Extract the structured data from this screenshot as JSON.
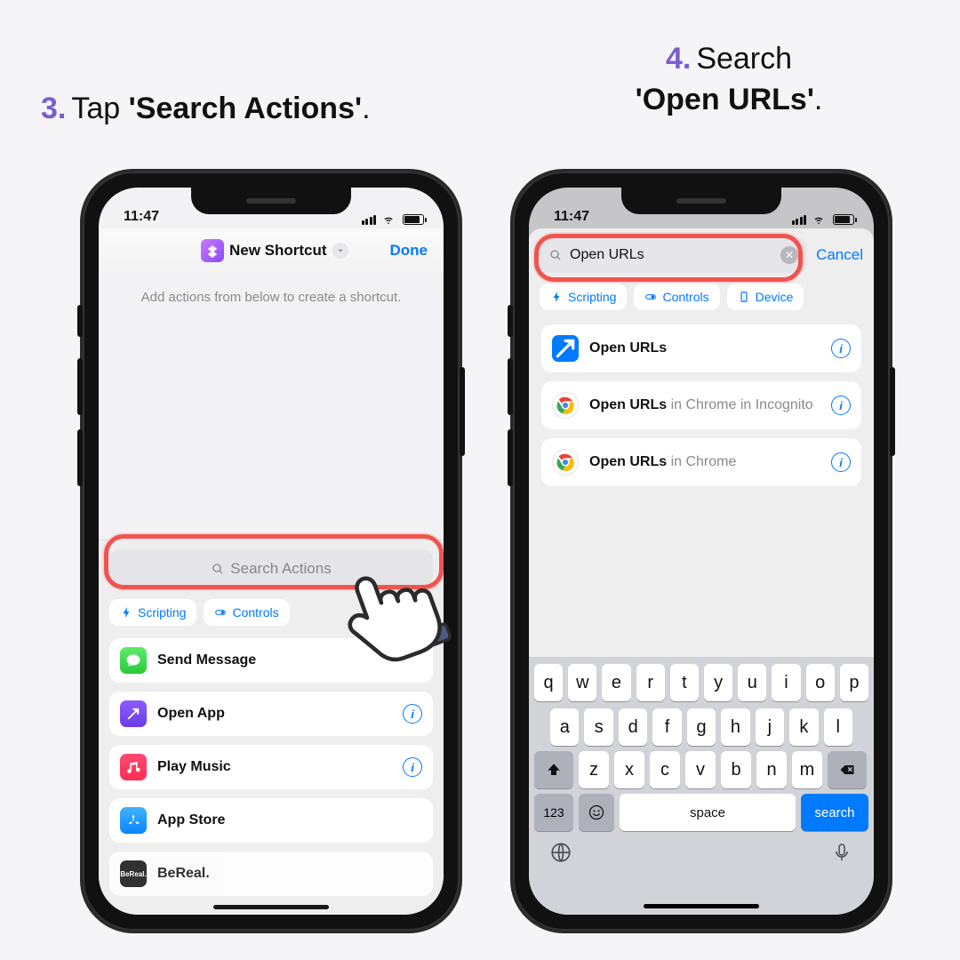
{
  "captions": {
    "step3": {
      "num": "3.",
      "pre": "Tap ",
      "bold": "'Search Actions'",
      "post": "."
    },
    "step4": {
      "num": "4.",
      "pre": "Search ",
      "bold": "'Open URLs'",
      "post": "."
    }
  },
  "status": {
    "time": "11:47"
  },
  "phone1": {
    "title": "New Shortcut",
    "done": "Done",
    "hint": "Add actions from below to create a shortcut.",
    "search_placeholder": "Search Actions",
    "chips": [
      "Scripting",
      "Controls"
    ],
    "rows": [
      {
        "icon": "messages",
        "title": "Send Message",
        "info": false
      },
      {
        "icon": "openapp",
        "title": "Open App",
        "info": true
      },
      {
        "icon": "music",
        "title": "Play Music",
        "info": true
      },
      {
        "icon": "appstore",
        "title": "App Store",
        "info": false
      },
      {
        "icon": "bereal",
        "title": "BeReal.",
        "info": false
      }
    ]
  },
  "phone2": {
    "search_value": "Open URLs",
    "cancel": "Cancel",
    "chips": [
      "Scripting",
      "Controls",
      "Device"
    ],
    "results": [
      {
        "icon": "safari",
        "title": "Open URLs",
        "suffix": ""
      },
      {
        "icon": "chrome",
        "title": "Open URLs",
        "suffix": " in Chrome in Incognito"
      },
      {
        "icon": "chrome",
        "title": "Open URLs",
        "suffix": " in Chrome"
      }
    ]
  },
  "keyboard": {
    "row1": [
      "q",
      "w",
      "e",
      "r",
      "t",
      "y",
      "u",
      "i",
      "o",
      "p"
    ],
    "row2": [
      "a",
      "s",
      "d",
      "f",
      "g",
      "h",
      "j",
      "k",
      "l"
    ],
    "row3": [
      "z",
      "x",
      "c",
      "v",
      "b",
      "n",
      "m"
    ],
    "num": "123",
    "space": "space",
    "search": "search"
  }
}
